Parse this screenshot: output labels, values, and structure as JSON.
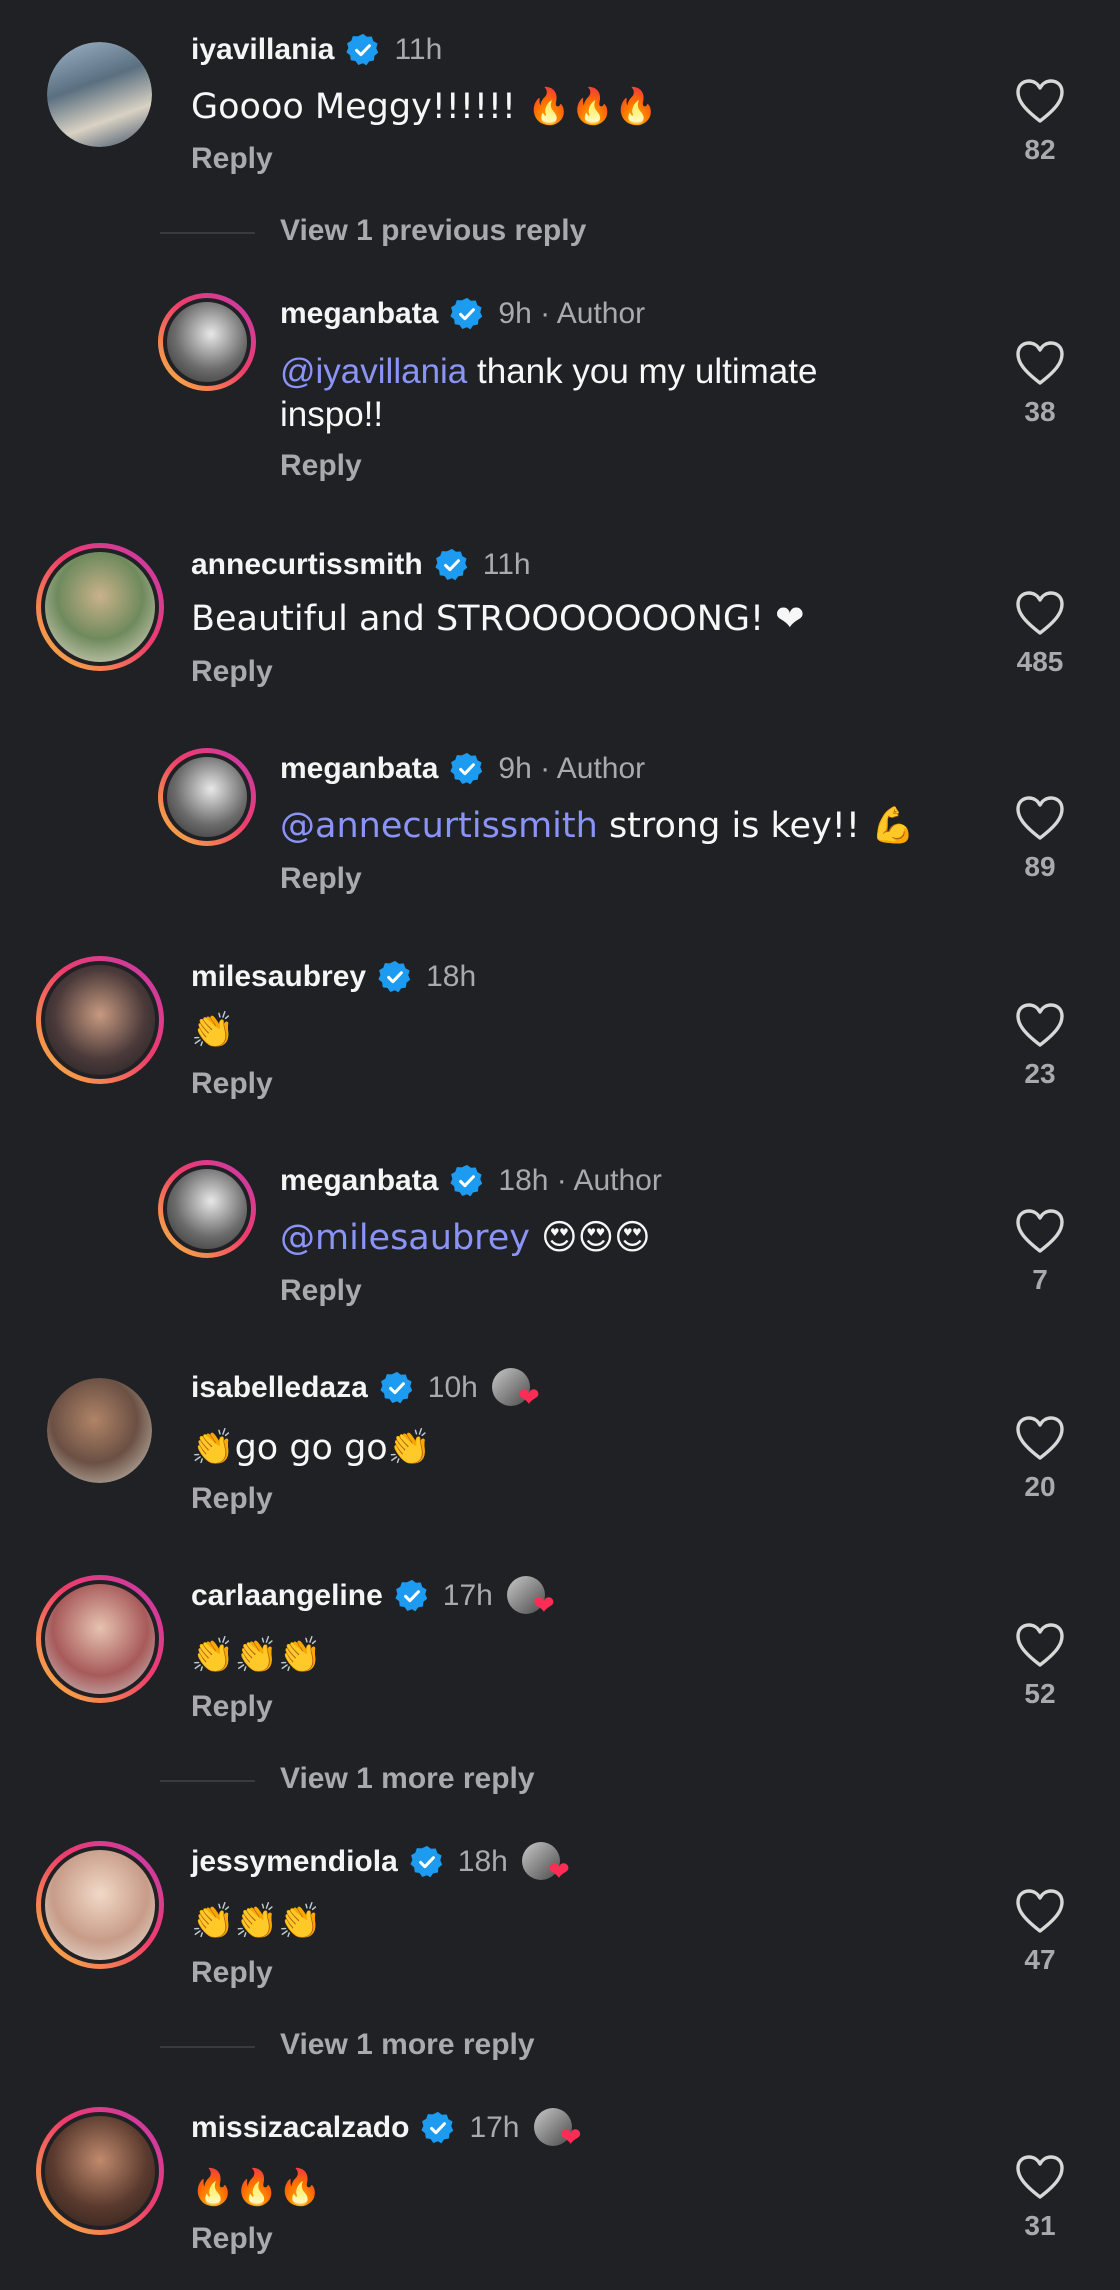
{
  "reply_label": "Reply",
  "colors": {
    "background": "#202124",
    "mention": "#8a94f8",
    "verified": "#1d9bf0",
    "muted": "#a9a9ae"
  },
  "comments": [
    {
      "user": "iyavillania",
      "time": "11h",
      "text": "Goooo Meggy!!!!!! 🔥🔥🔥",
      "likes": "82"
    },
    {
      "view_label": "View 1 previous reply"
    },
    {
      "user": "meganbata",
      "time": "9h · Author",
      "mention": "@iyavillania",
      "text": " thank you my ultimate inspo!!",
      "likes": "38"
    },
    {
      "user": "annecurtissmith",
      "time": "11h",
      "text": "Beautiful and STROOOOOOONG! ❤",
      "likes": "485"
    },
    {
      "user": "meganbata",
      "time": "9h · Author",
      "mention": "@annecurtissmith",
      "text": " strong is key!! 💪",
      "likes": "89"
    },
    {
      "user": "milesaubrey",
      "time": "18h",
      "text": "👏",
      "likes": "23"
    },
    {
      "user": "meganbata",
      "time": "18h · Author",
      "mention": "@milesaubrey",
      "text": " 😍😍😍",
      "likes": "7"
    },
    {
      "user": "isabelledaza",
      "time": "10h",
      "text": "👏go go go👏",
      "likes": "20"
    },
    {
      "user": "carlaangeline",
      "time": "17h",
      "text": "👏👏👏",
      "likes": "52"
    },
    {
      "view_label": "View 1 more reply"
    },
    {
      "user": "jessymendiola",
      "time": "18h",
      "text": "👏👏👏",
      "likes": "47"
    },
    {
      "view_label": "View 1 more reply"
    },
    {
      "user": "missizacalzado",
      "time": "17h",
      "text": "🔥🔥🔥",
      "likes": "31"
    }
  ]
}
